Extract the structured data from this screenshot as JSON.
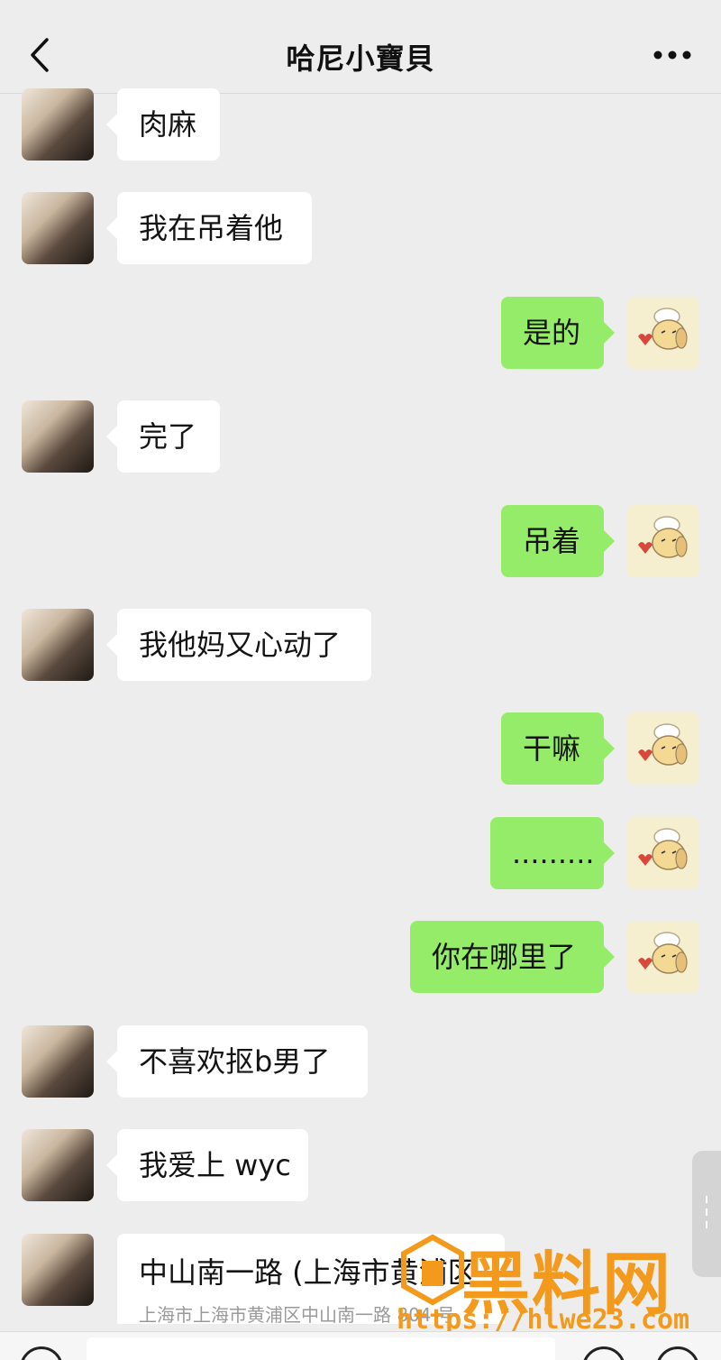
{
  "header": {
    "title": "哈尼小寶貝",
    "back_icon": "chevron-left-icon",
    "more_icon": "more-dots-icon"
  },
  "messages": [
    {
      "side": "left",
      "text": "肉麻"
    },
    {
      "side": "left",
      "text": "我在吊着他"
    },
    {
      "side": "right",
      "text": "是的"
    },
    {
      "side": "left",
      "text": "完了"
    },
    {
      "side": "right",
      "text": "吊着"
    },
    {
      "side": "left",
      "text": "我他妈又心动了"
    },
    {
      "side": "right",
      "text": "干嘛"
    },
    {
      "side": "right",
      "text": "........."
    },
    {
      "side": "right",
      "text": "你在哪里了"
    },
    {
      "side": "left",
      "text": "不喜欢抠b男了"
    },
    {
      "side": "left",
      "text": "我爱上 wyc"
    }
  ],
  "location_card": {
    "title": "中山南一路 (上海市黄浦区",
    "address": "上海市上海市黄浦区中山南一路 804 号"
  },
  "watermark": {
    "name": "黑料网",
    "url": "https://hlwe23.com"
  },
  "colors": {
    "background": "#ededed",
    "incoming_bubble": "#ffffff",
    "outgoing_bubble": "#95ec69",
    "watermark": "#f39a1c"
  }
}
